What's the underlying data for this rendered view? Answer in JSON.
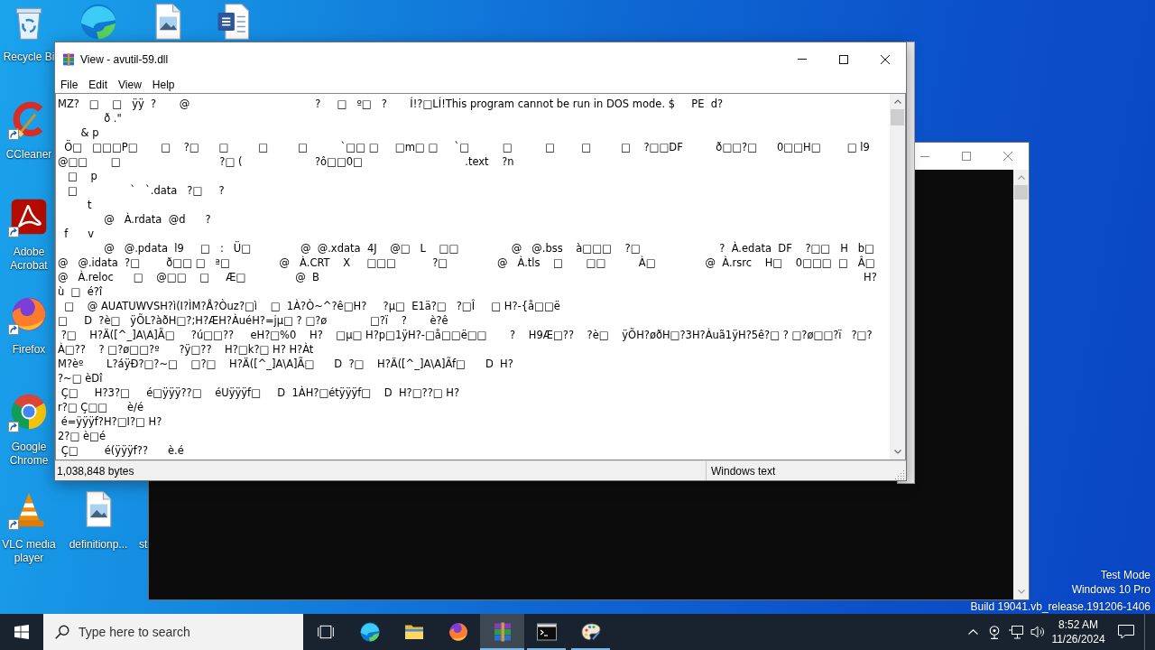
{
  "desktop": {
    "icons": [
      {
        "kind": "recycle-bin",
        "label": "Recycle Bi",
        "shortcut": false
      },
      {
        "kind": "edge",
        "shortcut": false
      },
      {
        "kind": "image-file",
        "shortcut": false
      },
      {
        "kind": "word-document",
        "shortcut": false
      },
      {
        "kind": "ccleaner",
        "label": "CCleaner",
        "shortcut": true
      },
      {
        "kind": "acrobat",
        "label": "Adobe Acrobat",
        "shortcut": true
      },
      {
        "kind": "firefox",
        "label": "Firefox",
        "shortcut": true
      },
      {
        "kind": "chrome",
        "label": "Google Chrome",
        "shortcut": true
      },
      {
        "kind": "vlc",
        "label": "VLC media player",
        "shortcut": true
      },
      {
        "kind": "image-file",
        "label": "definitionp...",
        "shortcut": false
      },
      {
        "kind": "hidden",
        "label": "st",
        "shortcut": false
      }
    ],
    "system_info": [
      "Test Mode",
      "Windows 10 Pro",
      "Build 19041.vb_release.191206-1406"
    ]
  },
  "background_windows": [
    {
      "kind": "console"
    },
    {
      "kind": "frame"
    }
  ],
  "viewer": {
    "title": "View - avutil-59.dll",
    "menu": [
      "File",
      "Edit",
      "View",
      "Help"
    ],
    "lines": [
      "MZ?   □    □   ÿÿ  ?       @                                      ?     □   º□   ?       Í!?□LÍ!This program cannot be run in DOS mode. $     PE  d?",
      "              ð .\"",
      "       & p",
      "  Ö□   □□□P□       □    ?□      □         □         □          `□□ □     □m□ □     `□          □          □        □         □    ?□□DF          ð□□?□      0□□H□        □ l9",
      "@□□       □                              ?□ (                      ?ô□□0□                               .text    ?n",
      "   □    p",
      "   □                `   `.data   ?□     ?",
      "         t",
      "              @   À.rdata  @d      ?",
      "  f      v",
      "              @   @.pdata  l9     □   :   Ü□               @  @.xdata  4J    @□   L    □□                @   @.bss    à□□□    ?□                        ?  À.edata  DF    ?□□   H   b□",
      "@   @.idata  ?□        ð□□ □   ª□               @   À.CRT    X     □□□           ?□               @   À.tls    □       □□          À□               @  À.rsrc    H□    0□□□  □   Â□",
      "@   À.reloc      □    @□□    □     Æ□               @  B                                                                                                                                                                     H?",
      "ù  □  é?î",
      "  □    @ AUATUWVSH?ì(I?ÌM?Å?Òuz?□ì    □  1À?Ò~^?ê□H?     ?µ□  E1ä?□   ?□Î     □ H?-{å□□ë",
      "□     D  ?è□   ÿÕL?àðH□?;H?ÆH?ÀuéH?=jµ□ ? □?ø             □?ï    ?       è?ê",
      " ?□    H?Ä([^_]A\\A]Ã□     ?ú□□??     eH?□%0    H?    □µ□ H?p□1ÿH?-□å□□ë□□       ?    H9Æ□??    ?è□    ÿÕH?øðH□?3H?Àuã1ÿH?5ê?□ ? □?ø□□?ï   ?□?",
      "À□??    ? □?ø□□?º      ?ÿ□??    H?□k?□ H? H?Àt",
      "M?èº       L?áÿÐ?□?~□    □?□    H?Ä([^_]A\\A]Ã□      D  ?□    H?Ä([^_]A\\A]Ãf□      D  H?",
      "?~□ èDî",
      " Ç□     H?3?□     é□ÿÿÿ??□    éUÿÿÿf□     D  1ÀH?□étÿÿÿf□    D  H?□??□ H?",
      "r?□ Ç□□      è/é",
      " é=ÿÿÿf?H?□I?□ H?",
      "2?□ è□é",
      " Ç□        é(ÿÿÿf??      è.é"
    ],
    "status": [
      "1,038,848 bytes",
      "Windows text"
    ]
  },
  "taskbar": {
    "search": {
      "placeholder": "Type here to search"
    },
    "apps": [
      {
        "kind": "task-view",
        "running": false,
        "selected": false
      },
      {
        "kind": "edge",
        "running": false,
        "selected": false
      },
      {
        "kind": "explorer",
        "running": false,
        "selected": false
      },
      {
        "kind": "firefox",
        "running": false,
        "selected": false
      },
      {
        "kind": "winrar",
        "running": true,
        "selected": true
      },
      {
        "kind": "terminal",
        "running": true,
        "selected": false
      },
      {
        "kind": "paint",
        "running": true,
        "selected": false
      }
    ],
    "clock": {
      "time": "8:52 AM",
      "date": "11/26/2024"
    }
  }
}
